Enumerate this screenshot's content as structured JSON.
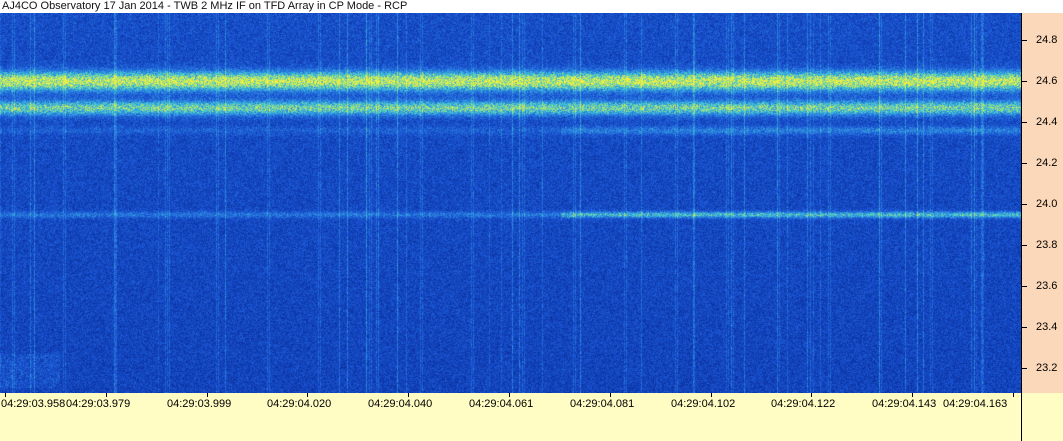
{
  "window": {
    "title": "AJ4CO Observatory 17 Jan 2014 - TWB 2 MHz IF on TFD Array in CP Mode - RCP"
  },
  "colors": {
    "plot_background": "#0b2b92",
    "time_axis_background": "#fffcc4",
    "freq_axis_background": "#fbd8b9"
  },
  "chart_data": {
    "type": "heatmap",
    "title": "AJ4CO Observatory 17 Jan 2014 - TWB 2 MHz IF on TFD Array in CP Mode - RCP",
    "xlabel": "",
    "ylabel": "",
    "x_ticks": [
      "04:29:03.958",
      "04:29:03.979",
      "04:29:03.999",
      "04:29:04.020",
      "04:29:04.040",
      "04:29:04.061",
      "04:29:04.081",
      "04:29:04.102",
      "04:29:04.122",
      "04:29:04.143",
      "04:29:04.163"
    ],
    "y_ticks": [
      "24.8",
      "24.6",
      "24.4",
      "24.2",
      "24.0",
      "23.8",
      "23.6",
      "23.4",
      "23.2"
    ],
    "y_tick_values": [
      24.8,
      24.6,
      24.4,
      24.2,
      24.0,
      23.8,
      23.6,
      23.4,
      23.2
    ],
    "ylim": [
      23.08,
      24.93
    ],
    "xlim": [
      "04:29:03.958",
      "04:29:04.163"
    ],
    "colormap": [
      "#071d7a",
      "#0c36a8",
      "#1b55d4",
      "#2d8ae0",
      "#3fc4d8",
      "#9ee07a",
      "#f4f040"
    ],
    "bands": [
      {
        "freq": 24.6,
        "width": 0.045,
        "intensity": 0.75
      },
      {
        "freq": 24.47,
        "width": 0.035,
        "intensity": 0.55
      },
      {
        "freq": 24.36,
        "width": 0.02,
        "intensity": 0.22
      },
      {
        "freq": 23.95,
        "width": 0.015,
        "intensity": 0.45
      }
    ],
    "grid": false,
    "legend": "none"
  }
}
